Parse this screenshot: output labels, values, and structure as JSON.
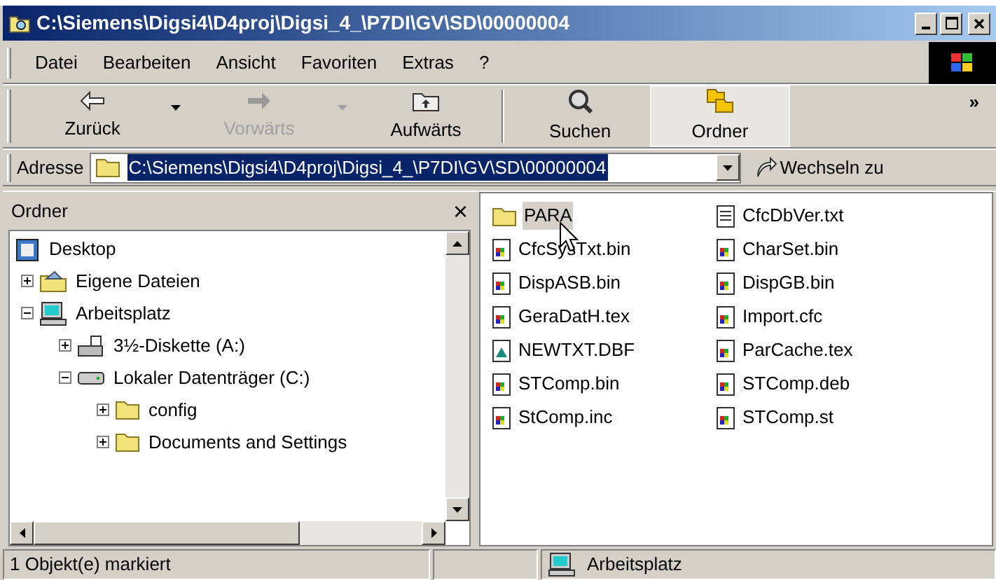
{
  "window": {
    "title": "C:\\Siemens\\Digsi4\\D4proj\\Digsi_4_\\P7DI\\GV\\SD\\00000004"
  },
  "menu": [
    "Datei",
    "Bearbeiten",
    "Ansicht",
    "Favoriten",
    "Extras",
    "?"
  ],
  "toolbar": [
    {
      "label": "Zurück",
      "kind": "back",
      "disabled": false,
      "dropdown": true,
      "selected": false
    },
    {
      "label": "Vorwärts",
      "kind": "forward",
      "disabled": true,
      "dropdown": true,
      "selected": false
    },
    {
      "label": "Aufwärts",
      "kind": "up",
      "disabled": false,
      "dropdown": false,
      "selected": false
    },
    {
      "label": "Suchen",
      "kind": "search",
      "disabled": false,
      "dropdown": false,
      "selected": false
    },
    {
      "label": "Ordner",
      "kind": "folders",
      "disabled": false,
      "dropdown": false,
      "selected": true
    }
  ],
  "toolbar_more": "»",
  "address": {
    "label": "Adresse",
    "value": "C:\\Siemens\\Digsi4\\D4proj\\Digsi_4_\\P7DI\\GV\\SD\\00000004",
    "go": "Wechseln zu"
  },
  "folders_pane": {
    "title": "Ordner",
    "close": "×",
    "tree": [
      {
        "label": "Desktop",
        "kind": "desktop",
        "children": [
          {
            "label": "Eigene Dateien",
            "kind": "mydocs",
            "expanded": false
          },
          {
            "label": "Arbeitsplatz",
            "kind": "computer",
            "expanded": true,
            "children": [
              {
                "label": "3½-Diskette (A:)",
                "kind": "floppy",
                "expanded": false
              },
              {
                "label": "Lokaler Datenträger (C:)",
                "kind": "drive",
                "expanded": true,
                "children": [
                  {
                    "label": "config",
                    "kind": "folder",
                    "expanded": false
                  },
                  {
                    "label": "Documents and Settings",
                    "kind": "folder",
                    "expanded": false
                  }
                ]
              }
            ]
          }
        ]
      }
    ]
  },
  "files": [
    {
      "name": "PARA",
      "kind": "folder",
      "selected": true
    },
    {
      "name": "CfcSysTxt.bin",
      "kind": "bin",
      "selected": false
    },
    {
      "name": "DispASB.bin",
      "kind": "bin",
      "selected": false
    },
    {
      "name": "GeraDatH.tex",
      "kind": "bin",
      "selected": false
    },
    {
      "name": "NEWTXT.DBF",
      "kind": "db",
      "selected": false
    },
    {
      "name": "STComp.bin",
      "kind": "bin",
      "selected": false
    },
    {
      "name": "StComp.inc",
      "kind": "bin",
      "selected": false
    },
    {
      "name": "CfcDbVer.txt",
      "kind": "text",
      "selected": false
    },
    {
      "name": "CharSet.bin",
      "kind": "bin",
      "selected": false
    },
    {
      "name": "DispGB.bin",
      "kind": "bin",
      "selected": false
    },
    {
      "name": "Import.cfc",
      "kind": "bin",
      "selected": false
    },
    {
      "name": "ParCache.tex",
      "kind": "bin",
      "selected": false
    },
    {
      "name": "STComp.deb",
      "kind": "bin",
      "selected": false
    },
    {
      "name": "STComp.st",
      "kind": "bin",
      "selected": false
    }
  ],
  "status_bar": {
    "left": "1 Objekt(e) markiert",
    "right": "Arbeitsplatz"
  }
}
